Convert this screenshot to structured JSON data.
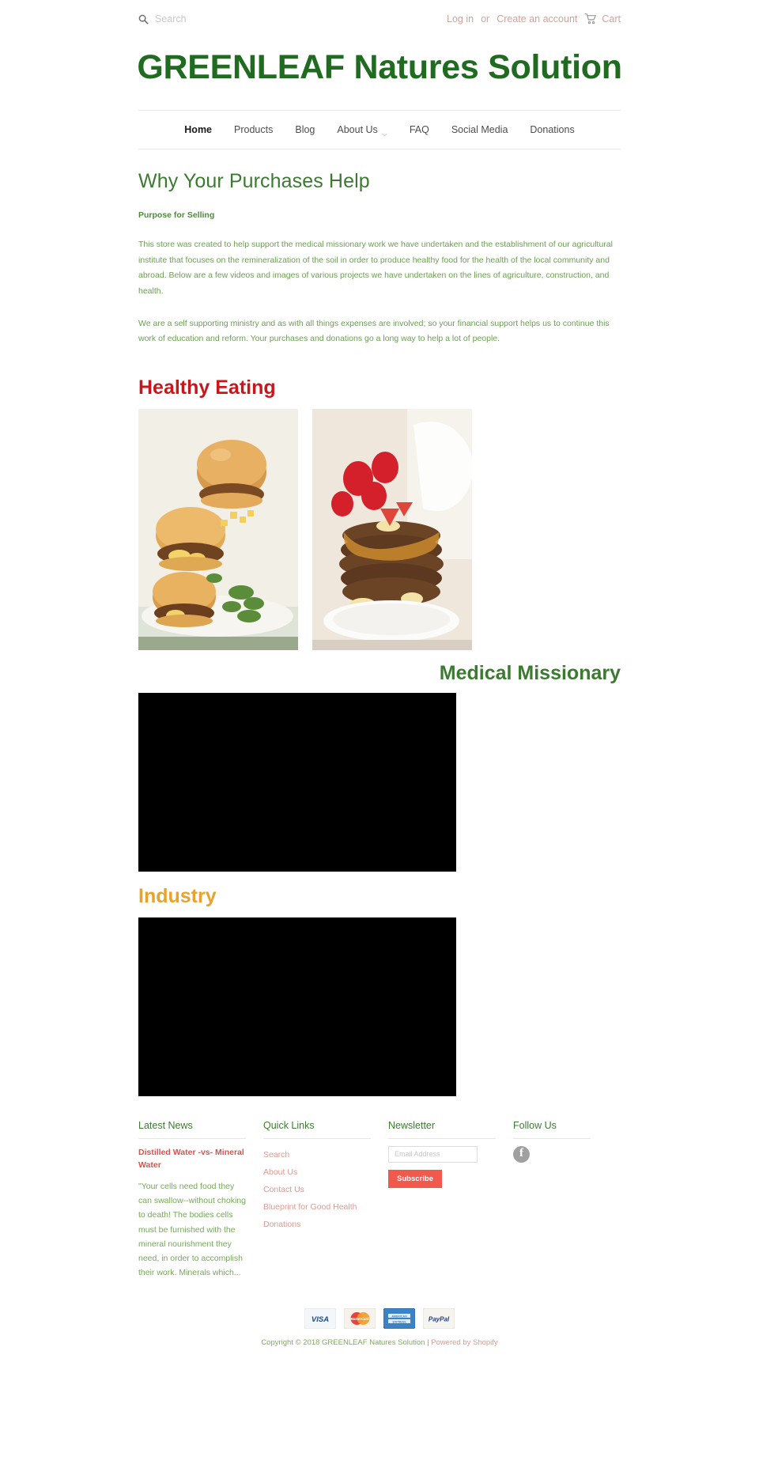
{
  "topbar": {
    "search_placeholder": "Search",
    "search_value": "",
    "login_label": "Log in",
    "or_label": "or",
    "create_account_label": "Create an account",
    "cart_label": "Cart"
  },
  "site": {
    "title": "GREENLEAF Natures Solution",
    "title_color": "#1f6b1f"
  },
  "nav": {
    "items": [
      {
        "label": "Home",
        "active": true,
        "caret": false
      },
      {
        "label": "Products",
        "active": false,
        "caret": false
      },
      {
        "label": "Blog",
        "active": false,
        "caret": false
      },
      {
        "label": "About Us",
        "active": false,
        "caret": true
      },
      {
        "label": "FAQ",
        "active": false,
        "caret": false
      },
      {
        "label": "Social Media",
        "active": false,
        "caret": false
      },
      {
        "label": "Donations",
        "active": false,
        "caret": false
      }
    ]
  },
  "main": {
    "page_title": "Why Your Purchases Help",
    "purpose_heading": "Purpose for Selling",
    "paragraph_1": "This store was created to help support the medical missionary work we have undertaken and the establishment of our agricultural institute that focuses on the remineralization of the soil in order to produce healthy food for the health of the local community and abroad. Below are a few videos and images of various projects we have undertaken on the lines of agriculture, construction, and health.",
    "paragraph_2": "We are a self supporting ministry and as with all things expenses are involved; so your financial support helps us to continue this work of education and reform.  Your purchases and donations go a long way to help a lot of people.",
    "sections": [
      {
        "label": "Healthy Eating",
        "color": "#c8171c"
      },
      {
        "label": "Medical Missionary",
        "color": "#3d7a31"
      },
      {
        "label": "Industry",
        "color": "#e8a32c"
      }
    ]
  },
  "footer": {
    "latest_news": {
      "heading": "Latest News",
      "article_title": "Distilled Water -vs- Mineral Water",
      "excerpt": "\"Your cells need food they can swallow--without choking to death! The bodies cells must be furnished with the mineral nourishment they need, in order to accomplish their work. Minerals which..."
    },
    "quick_links": {
      "heading": "Quick Links",
      "items": [
        "Search",
        "About Us",
        "Contact Us",
        "Blueprint for Good Health",
        "Donations"
      ]
    },
    "newsletter": {
      "heading": "Newsletter",
      "email_placeholder": "Email Address",
      "email_value": "",
      "subscribe_label": "Subscribe",
      "button_color": "#ef5a4c"
    },
    "follow_us": {
      "heading": "Follow Us",
      "networks": [
        "facebook"
      ]
    }
  },
  "bottom": {
    "payment_methods": [
      "VISA",
      "MasterCard",
      "American Express",
      "PayPal"
    ],
    "copyright": "Copyright © 2018 GREENLEAF Natures Solution | ",
    "powered_by": "Powered by Shopify"
  }
}
